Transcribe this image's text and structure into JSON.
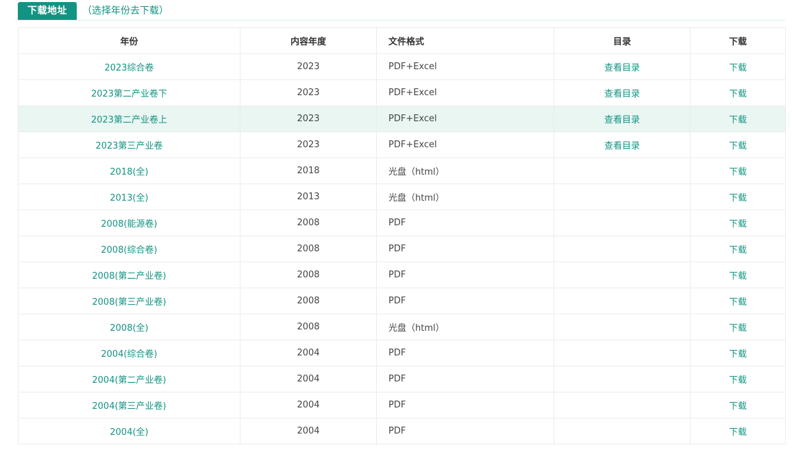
{
  "section": {
    "title": "下载地址",
    "hint": "（选择年份去下载）"
  },
  "table": {
    "headers": [
      "年份",
      "内容年度",
      "文件格式",
      "目录",
      "下载"
    ],
    "rows": [
      {
        "year": "2023综合卷",
        "content_year": "2023",
        "format": "PDF+Excel",
        "catalog": "查看目录",
        "download": "下载"
      },
      {
        "year": "2023第二产业卷下",
        "content_year": "2023",
        "format": "PDF+Excel",
        "catalog": "查看目录",
        "download": "下载"
      },
      {
        "year": "2023第二产业卷上",
        "content_year": "2023",
        "format": "PDF+Excel",
        "catalog": "查看目录",
        "download": "下载",
        "highlighted": true
      },
      {
        "year": "2023第三产业卷",
        "content_year": "2023",
        "format": "PDF+Excel",
        "catalog": "查看目录",
        "download": "下载"
      },
      {
        "year": "2018(全)",
        "content_year": "2018",
        "format": "光盘（html）",
        "catalog": "",
        "download": "下载"
      },
      {
        "year": "2013(全)",
        "content_year": "2013",
        "format": "光盘（html）",
        "catalog": "",
        "download": "下载"
      },
      {
        "year": "2008(能源卷)",
        "content_year": "2008",
        "format": "PDF",
        "catalog": "",
        "download": "下载"
      },
      {
        "year": "2008(综合卷)",
        "content_year": "2008",
        "format": "PDF",
        "catalog": "",
        "download": "下载"
      },
      {
        "year": "2008(第二产业卷)",
        "content_year": "2008",
        "format": "PDF",
        "catalog": "",
        "download": "下载"
      },
      {
        "year": "2008(第三产业卷)",
        "content_year": "2008",
        "format": "PDF",
        "catalog": "",
        "download": "下载"
      },
      {
        "year": "2008(全)",
        "content_year": "2008",
        "format": "光盘（html）",
        "catalog": "",
        "download": "下载"
      },
      {
        "year": "2004(综合卷)",
        "content_year": "2004",
        "format": "PDF",
        "catalog": "",
        "download": "下载"
      },
      {
        "year": "2004(第二产业卷)",
        "content_year": "2004",
        "format": "PDF",
        "catalog": "",
        "download": "下载"
      },
      {
        "year": "2004(第三产业卷)",
        "content_year": "2004",
        "format": "PDF",
        "catalog": "",
        "download": "下载"
      },
      {
        "year": "2004(全)",
        "content_year": "2004",
        "format": "PDF",
        "catalog": "",
        "download": "下载"
      }
    ]
  },
  "colors": {
    "accent": "#129482",
    "highlight_row": "#e9f6f2"
  }
}
